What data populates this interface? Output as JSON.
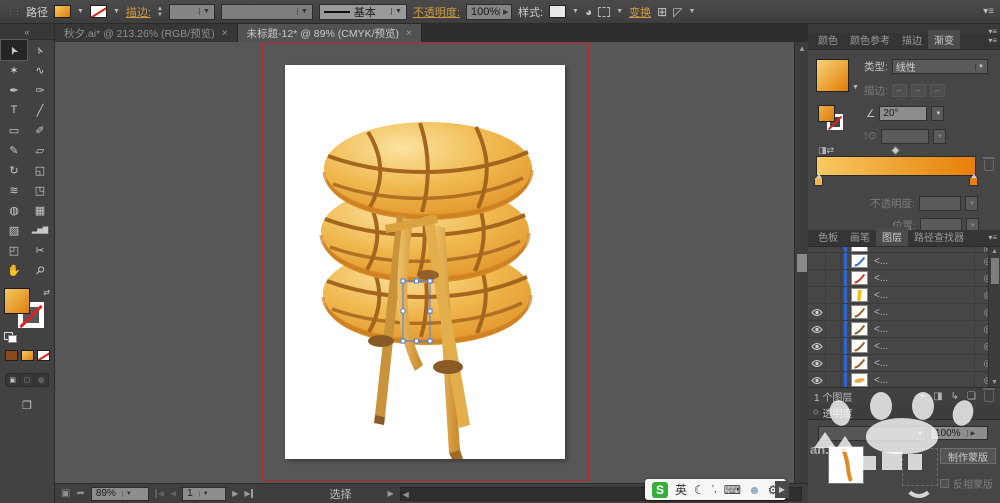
{
  "control_bar": {
    "object_label": "路径",
    "stroke_link": "描边:",
    "brush_value": "基本",
    "opacity_link": "不透明度:",
    "opacity_value": "100%",
    "style_label": "样式:",
    "transform_link": "变换"
  },
  "document_tabs": [
    {
      "title": "秋夕.ai* @ 213.26% (RGB/预览)",
      "close": "×",
      "active": false
    },
    {
      "title": "未标题-12* @ 89% (CMYK/预览)",
      "close": "×",
      "active": true
    }
  ],
  "tools": [
    {
      "name": "selection",
      "glyph": "➤",
      "selected": true
    },
    {
      "name": "direct-selection",
      "glyph": "➢",
      "selected": false
    },
    {
      "name": "magic-wand",
      "glyph": "✶",
      "selected": false
    },
    {
      "name": "lasso",
      "glyph": "∿",
      "selected": false
    },
    {
      "name": "pen",
      "glyph": "✒",
      "selected": false
    },
    {
      "name": "blob-brush",
      "glyph": "✑",
      "selected": false
    },
    {
      "name": "type",
      "glyph": "T",
      "selected": false
    },
    {
      "name": "line-segment",
      "glyph": "╱",
      "selected": false
    },
    {
      "name": "rectangle",
      "glyph": "▭",
      "selected": false
    },
    {
      "name": "paintbrush",
      "glyph": "✐",
      "selected": false
    },
    {
      "name": "pencil",
      "glyph": "✎",
      "selected": false
    },
    {
      "name": "eraser",
      "glyph": "▱",
      "selected": false
    },
    {
      "name": "rotate",
      "glyph": "↻",
      "selected": false
    },
    {
      "name": "scale",
      "glyph": "◱",
      "selected": false
    },
    {
      "name": "width",
      "glyph": "≋",
      "selected": false
    },
    {
      "name": "free-transform",
      "glyph": "◳",
      "selected": false
    },
    {
      "name": "shape-builder",
      "glyph": "◍",
      "selected": false
    },
    {
      "name": "perspective-grid",
      "glyph": "▦",
      "selected": false
    },
    {
      "name": "symbol-sprayer",
      "glyph": "▨",
      "selected": false
    },
    {
      "name": "column-graph",
      "glyph": "▂▅▇",
      "selected": false
    },
    {
      "name": "artboard",
      "glyph": "◰",
      "selected": false
    },
    {
      "name": "slice",
      "glyph": "✂",
      "selected": false
    },
    {
      "name": "hand",
      "glyph": "✋",
      "selected": false
    },
    {
      "name": "zoom",
      "glyph": "⚲",
      "selected": false
    }
  ],
  "gradient_panel": {
    "tabs": [
      "颜色",
      "颜色参考",
      "描边",
      "渐变"
    ],
    "active_tab": "渐变",
    "type_label": "类型:",
    "type_value": "线性",
    "stroke_label": "描边:",
    "angle_value": "20°",
    "opacity_label": "不透明度:",
    "location_label": "位置:",
    "gradient_start": "#F8C963",
    "gradient_end": "#E87F06"
  },
  "layers_panel": {
    "tabs": [
      "色板",
      "画笔",
      "图层",
      "路径查找器"
    ],
    "active_tab": "图层",
    "rows": [
      {
        "thumb": "blank",
        "color": "#FFFFFF",
        "eye": false,
        "label": ""
      },
      {
        "thumb": "curve",
        "color": "#2E6FD2",
        "eye": false,
        "label": "<..."
      },
      {
        "thumb": "curve",
        "color": "#D3362B",
        "eye": false,
        "label": "<..."
      },
      {
        "thumb": "wedge",
        "color": "#F4C212",
        "eye": false,
        "label": "<..."
      },
      {
        "thumb": "curve",
        "color": "#9A5B22",
        "eye": true,
        "label": "<..."
      },
      {
        "thumb": "curve",
        "color": "#8F5420",
        "eye": true,
        "label": "<..."
      },
      {
        "thumb": "curve",
        "color": "#9A5B22",
        "eye": true,
        "label": "<..."
      },
      {
        "thumb": "curve",
        "color": "#9A5B22",
        "eye": true,
        "label": "<..."
      },
      {
        "thumb": "leaf",
        "color": "#E2B04A",
        "eye": true,
        "label": "<..."
      }
    ],
    "status": "1 个图层"
  },
  "transparency_panel": {
    "title": "透明度",
    "opacity_value": "100%",
    "make_mask": "制作蒙版",
    "invert_mask": "反相蒙版"
  },
  "status_bar": {
    "zoom": "89%",
    "artboard": "1",
    "status": "选择"
  },
  "ime": {
    "logo": "S",
    "lang": "英"
  },
  "watermark": {
    "fragment": "an.l"
  },
  "artwork_colors": {
    "cushion_light": "#FBE3A0",
    "cushion_mid": "#F0B84E",
    "cushion_dark": "#D98C26",
    "rope": "#A4661F",
    "wood_light": "#EDC268",
    "wood_dark": "#C8862A",
    "lash": "#8A5A26",
    "selection_blue": "#4A79DD",
    "guide_red": "#B5272B"
  }
}
